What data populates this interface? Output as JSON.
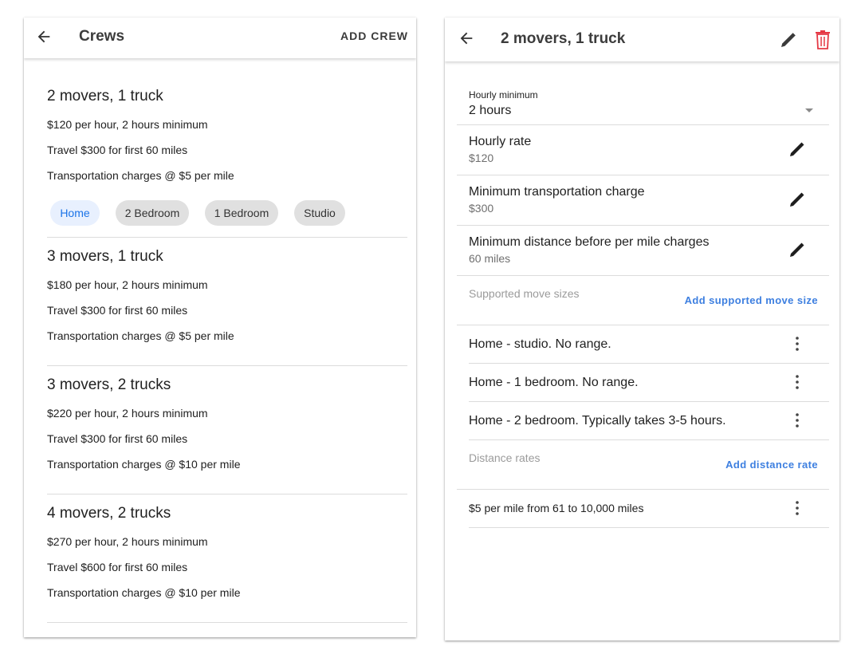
{
  "left": {
    "title": "Crews",
    "add_crew_label": "ADD CREW",
    "crews": [
      {
        "title": "2 movers, 1 truck",
        "rate": "$120 per hour, 2 hours minimum",
        "travel": "Travel $300 for first 60 miles",
        "transport": "Transportation charges @ $5 per mile"
      },
      {
        "title": "3 movers, 1 truck",
        "rate": "$180 per hour, 2 hours minimum",
        "travel": "Travel $300 for first 60 miles",
        "transport": "Transportation charges @ $5 per mile"
      },
      {
        "title": "3 movers, 2 trucks",
        "rate": "$220 per hour, 2 hours minimum",
        "travel": "Travel $300 for first 60 miles",
        "transport": "Transportation charges @ $10 per mile"
      },
      {
        "title": "4 movers, 2 trucks",
        "rate": "$270 per hour, 2 hours minimum",
        "travel": "Travel $600 for first 60 miles",
        "transport": "Transportation charges @ $10 per mile"
      }
    ],
    "chips": [
      "Home",
      "2 Bedroom",
      "1 Bedroom",
      "Studio"
    ]
  },
  "right": {
    "title": "2 movers, 1 truck",
    "hourly_minimum": {
      "label": "Hourly minimum",
      "value": "2 hours"
    },
    "fields": [
      {
        "title": "Hourly rate",
        "value": "$120"
      },
      {
        "title": "Minimum transportation charge",
        "value": "$300"
      },
      {
        "title": "Minimum distance before per mile charges",
        "value": "60 miles"
      }
    ],
    "move_sizes": {
      "label": "Supported move sizes",
      "add_label": "Add supported move size",
      "items": [
        "Home - studio. No range.",
        "Home - 1 bedroom. No range.",
        "Home - 2 bedroom. Typically takes 3-5 hours."
      ]
    },
    "distance_rates": {
      "label": "Distance rates",
      "add_label": "Add distance rate",
      "items": [
        "$5 per mile from 61 to 10,000 miles"
      ]
    }
  },
  "colors": {
    "accent": "#1a73e8",
    "link": "#3d7fe0",
    "delete": "#e53945",
    "chip_selected_bg": "#e8f0fe",
    "chip_bg": "#e0e0e0"
  }
}
